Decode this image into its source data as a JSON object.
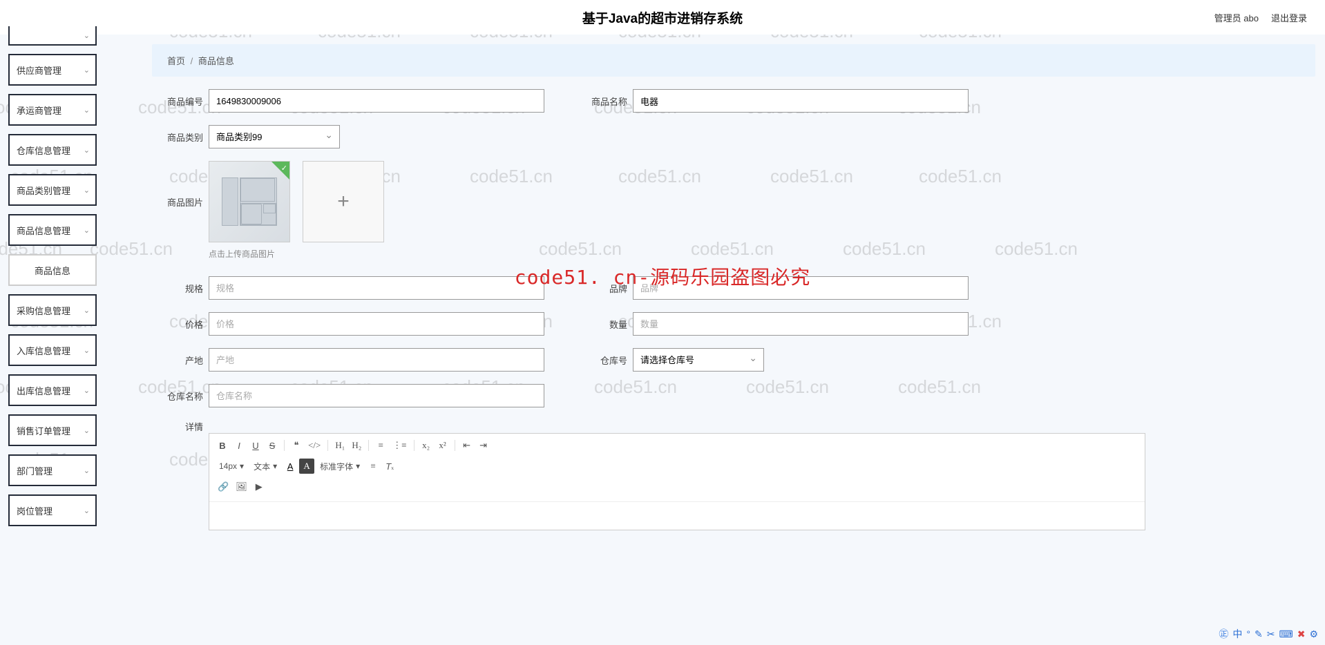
{
  "header": {
    "title": "基于Java的超市进销存系统",
    "user_label": "管理员 abo",
    "logout": "退出登录"
  },
  "sidebar": [
    {
      "label": "供应商管理",
      "expandable": true
    },
    {
      "label": "承运商管理",
      "expandable": true
    },
    {
      "label": "仓库信息管理",
      "expandable": true
    },
    {
      "label": "商品类别管理",
      "expandable": true
    },
    {
      "label": "商品信息管理",
      "expandable": true
    },
    {
      "label": "商品信息",
      "expandable": false,
      "active": true
    },
    {
      "label": "采购信息管理",
      "expandable": true
    },
    {
      "label": "入库信息管理",
      "expandable": true
    },
    {
      "label": "出库信息管理",
      "expandable": true
    },
    {
      "label": "销售订单管理",
      "expandable": true
    },
    {
      "label": "部门管理",
      "expandable": true
    },
    {
      "label": "岗位管理",
      "expandable": true
    }
  ],
  "breadcrumb": {
    "home": "首页",
    "current": "商品信息"
  },
  "form": {
    "product_id": {
      "label": "商品编号",
      "value": "1649830009006"
    },
    "product_name": {
      "label": "商品名称",
      "value": "电器"
    },
    "category": {
      "label": "商品类别",
      "value": "商品类别99"
    },
    "image": {
      "label": "商品图片",
      "hint": "点击上传商品图片"
    },
    "spec": {
      "label": "规格",
      "placeholder": "规格"
    },
    "brand": {
      "label": "品牌",
      "placeholder": "品牌"
    },
    "price": {
      "label": "价格",
      "placeholder": "价格"
    },
    "quantity": {
      "label": "数量",
      "placeholder": "数量"
    },
    "origin": {
      "label": "产地",
      "placeholder": "产地"
    },
    "warehouse_no": {
      "label": "仓库号",
      "placeholder": "请选择仓库号"
    },
    "warehouse_name": {
      "label": "仓库名称",
      "placeholder": "仓库名称"
    },
    "detail": {
      "label": "详情"
    }
  },
  "editor": {
    "font_size": "14px",
    "text_type": "文本",
    "font_family": "标准字体"
  },
  "watermark": {
    "text": "code51.cn",
    "center": "code51. cn-源码乐园盗图必究"
  },
  "tray": {
    "ime": "中"
  }
}
